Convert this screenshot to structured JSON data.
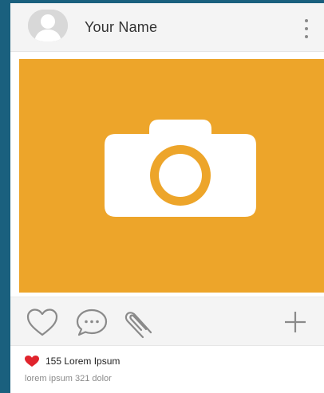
{
  "post": {
    "author": {
      "name": "Your Name"
    },
    "likes_text": "155 Lorem Ipsum",
    "caption": "lorem ipsum 321 dolor"
  },
  "icons": {
    "avatar": "user-placeholder-icon",
    "more": "vertical-dots-icon",
    "photo": "camera-icon",
    "like": "heart-outline-icon",
    "comment": "chat-bubble-icon",
    "attach": "paperclip-icon",
    "add": "plus-icon",
    "liked": "heart-filled-icon"
  },
  "colors": {
    "background": "#1a607e",
    "photo_placeholder": "#eda52a",
    "heart": "#e0242d",
    "icon_gray": "#8a8a8a"
  }
}
